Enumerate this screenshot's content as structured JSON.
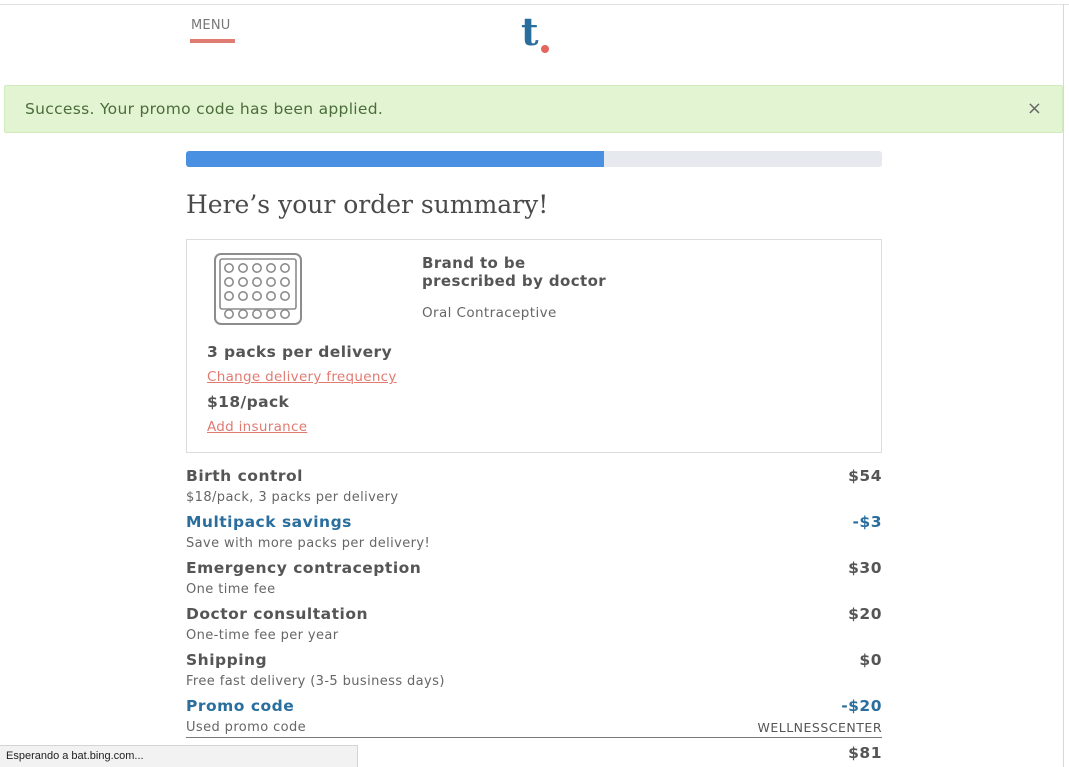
{
  "header": {
    "menu_label": "MENU",
    "logo_text": "t"
  },
  "alert": {
    "message": "Success. Your promo code has been applied.",
    "close_symbol": "×"
  },
  "progress": {
    "fraction": 0.6
  },
  "page": {
    "title": "Here’s your order summary!"
  },
  "product": {
    "icon": "pill-pack-icon",
    "brand": "Brand to be\nprescribed by doctor",
    "type": "Oral Contraceptive",
    "packs": "3 packs per delivery",
    "change_link": "Change delivery frequency",
    "price": "$18/pack",
    "insurance_link": "Add insurance"
  },
  "lines": [
    {
      "label": "Birth control",
      "desc": "$18/pack, 3 packs per delivery",
      "amount": "$54",
      "extra": ""
    },
    {
      "label": "Multipack savings",
      "desc": "Save with more packs per delivery!",
      "amount": "-$3",
      "extra": ""
    },
    {
      "label": "Emergency contraception",
      "desc": "One time fee",
      "amount": "$30",
      "extra": ""
    },
    {
      "label": "Doctor consultation",
      "desc": "One-time fee per year",
      "amount": "$20",
      "extra": ""
    },
    {
      "label": "Shipping",
      "desc": "Free fast delivery (3-5 business days)",
      "amount": "$0",
      "extra": ""
    },
    {
      "label": "Promo code",
      "desc": "Used promo code",
      "amount": "-$20",
      "extra": "WELLNESSCENTER"
    }
  ],
  "total": {
    "amount": "$81"
  },
  "status_bar": {
    "text": "Esperando a bat.bing.com..."
  },
  "colors": {
    "accent_coral": "#e07b72",
    "brand_blue": "#2a6e9e",
    "progress_blue": "#4a90e2",
    "success_bg": "#e3f4d3"
  }
}
